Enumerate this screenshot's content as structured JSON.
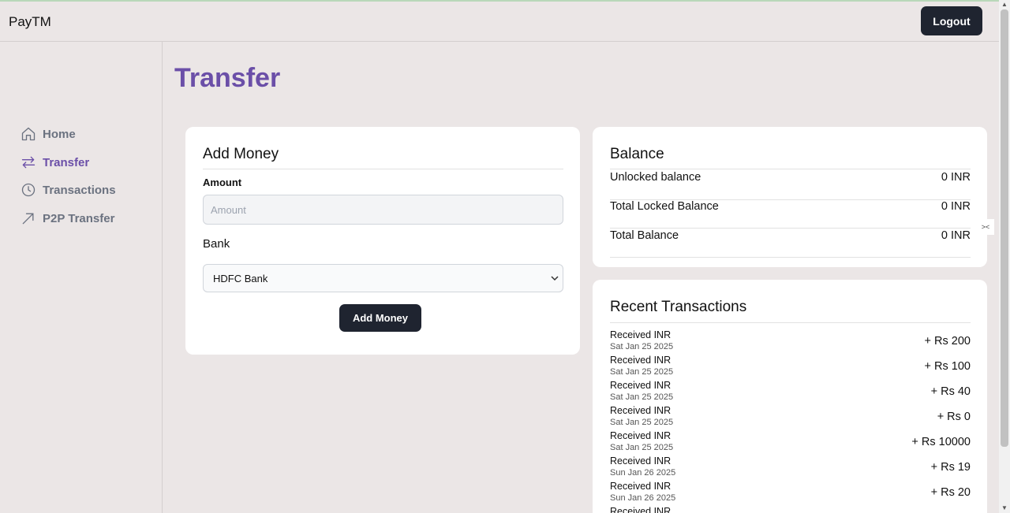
{
  "app": {
    "brand": "PayTM",
    "logout_label": "Logout"
  },
  "sidebar": {
    "items": [
      {
        "label": "Home",
        "icon": "home-icon",
        "active": false
      },
      {
        "label": "Transfer",
        "icon": "transfer-arrows-icon",
        "active": true
      },
      {
        "label": "Transactions",
        "icon": "clock-icon",
        "active": false
      },
      {
        "label": "P2P Transfer",
        "icon": "arrow-up-right-icon",
        "active": false
      }
    ]
  },
  "page": {
    "title": "Transfer"
  },
  "add_money": {
    "title": "Add Money",
    "amount_label": "Amount",
    "amount_placeholder": "Amount",
    "amount_value": "",
    "bank_label": "Bank",
    "bank_selected": "HDFC Bank",
    "button_label": "Add Money"
  },
  "balance": {
    "title": "Balance",
    "rows": [
      {
        "label": "Unlocked balance",
        "value": "0 INR"
      },
      {
        "label": "Total Locked Balance",
        "value": "0 INR"
      },
      {
        "label": "Total Balance",
        "value": "0 INR"
      }
    ]
  },
  "recent": {
    "title": "Recent Transactions",
    "items": [
      {
        "title": "Received INR",
        "date": "Sat Jan 25 2025",
        "amount": "+ Rs 200"
      },
      {
        "title": "Received INR",
        "date": "Sat Jan 25 2025",
        "amount": "+ Rs 100"
      },
      {
        "title": "Received INR",
        "date": "Sat Jan 25 2025",
        "amount": "+ Rs 40"
      },
      {
        "title": "Received INR",
        "date": "Sat Jan 25 2025",
        "amount": "+ Rs 0"
      },
      {
        "title": "Received INR",
        "date": "Sat Jan 25 2025",
        "amount": "+ Rs 10000"
      },
      {
        "title": "Received INR",
        "date": "Sun Jan 26 2025",
        "amount": "+ Rs 19"
      },
      {
        "title": "Received INR",
        "date": "Sun Jan 26 2025",
        "amount": "+ Rs 20"
      },
      {
        "title": "Received INR",
        "date": "",
        "amount": ""
      }
    ]
  },
  "colors": {
    "accent": "#6b4fa8",
    "button_dark": "#1f2430",
    "background": "#ebe6e6"
  }
}
